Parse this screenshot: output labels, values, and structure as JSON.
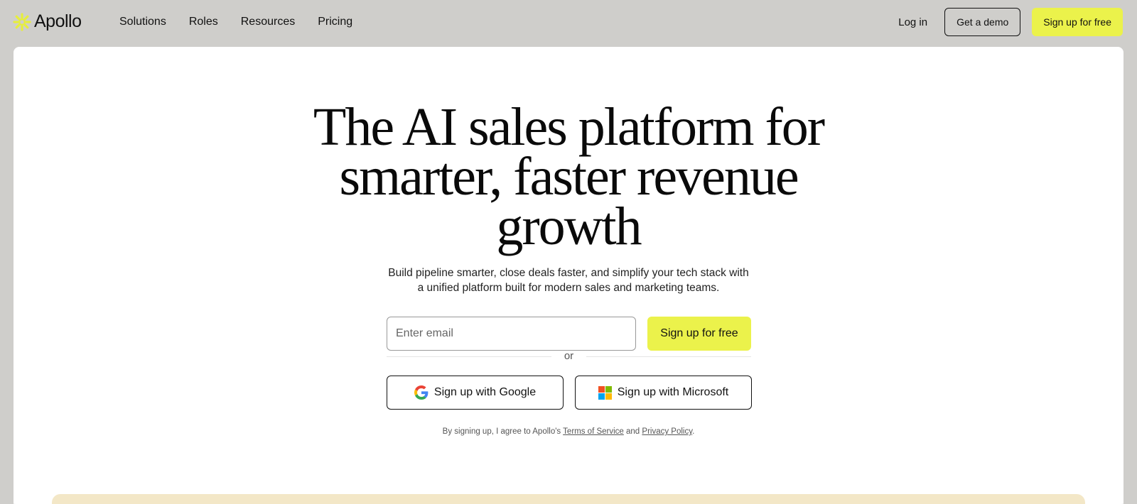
{
  "brand": {
    "name": "Apollo",
    "logo_icon": "apollo-asterisk-icon",
    "accent_color": "#ebf24b"
  },
  "nav": {
    "links": [
      "Solutions",
      "Roles",
      "Resources",
      "Pricing"
    ],
    "login": "Log in",
    "demo": "Get a demo",
    "signup": "Sign up for free"
  },
  "hero": {
    "headline_lines": [
      "The AI sales platform for",
      "smarter, faster revenue",
      "growth"
    ],
    "subtext_lines": [
      "Build pipeline smarter, close deals faster, and simplify your tech stack with",
      "a unified platform built for modern sales and marketing teams."
    ],
    "email_placeholder": "Enter email",
    "email_value": "",
    "signup_button": "Sign up for free",
    "or_text": "or",
    "google_button": "Sign up with Google",
    "microsoft_button": "Sign up with Microsoft",
    "legal": {
      "prefix": "By signing up, I agree to Apollo's",
      "terms": "Terms of Service",
      "and": "and",
      "privacy": "Privacy Policy",
      "suffix": "."
    }
  }
}
